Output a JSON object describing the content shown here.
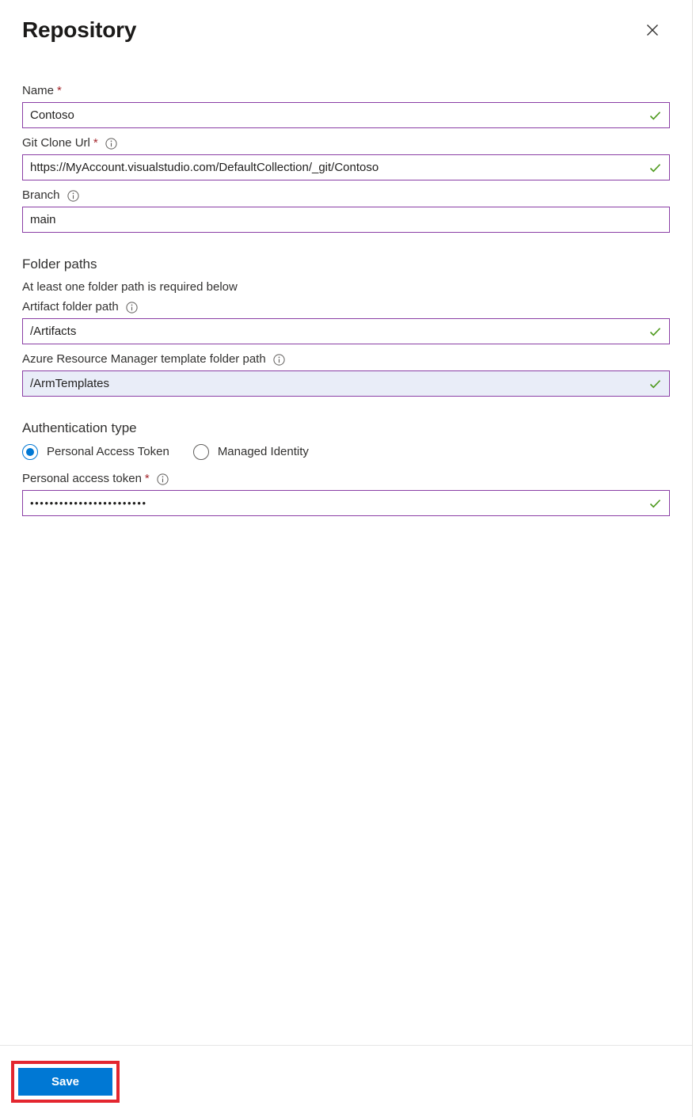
{
  "header": {
    "title": "Repository",
    "close_icon": "close-icon",
    "close_label": "Close"
  },
  "form": {
    "fields": [
      {
        "key": "name",
        "label": "Name",
        "required": true,
        "info": false,
        "value": "Contoso",
        "valid": true,
        "selected": false,
        "masked": false
      },
      {
        "key": "git_clone_url",
        "label": "Git Clone Url",
        "required": true,
        "info": true,
        "value": "https://MyAccount.visualstudio.com/DefaultCollection/_git/Contoso",
        "valid": true,
        "selected": false,
        "masked": false
      },
      {
        "key": "branch",
        "label": "Branch",
        "required": false,
        "info": true,
        "value": "main",
        "valid": false,
        "selected": false,
        "masked": false
      }
    ]
  },
  "folder_paths": {
    "section_title": "Folder paths",
    "hint": "At least one folder path is required below",
    "fields": [
      {
        "key": "artifact_folder_path",
        "label": "Artifact folder path",
        "required": false,
        "info": true,
        "value": "/Artifacts",
        "valid": true,
        "selected": false,
        "masked": false
      },
      {
        "key": "arm_template_folder_path",
        "label": "Azure Resource Manager template folder path",
        "required": false,
        "info": true,
        "value": "/ArmTemplates",
        "valid": true,
        "selected": true,
        "masked": false
      }
    ]
  },
  "authentication": {
    "section_title": "Authentication type",
    "options": [
      {
        "key": "personal-access-token",
        "label": "Personal Access Token",
        "checked": true
      },
      {
        "key": "managed-identity",
        "label": "Managed Identity",
        "checked": false
      }
    ],
    "token_field": {
      "key": "personal_access_token",
      "label": "Personal access token",
      "required": true,
      "info": true,
      "value": "••••••••••••••••••••••••",
      "valid": true,
      "selected": false,
      "masked": true
    }
  },
  "footer": {
    "save_label": "Save",
    "highlight_color": "#e3262f"
  },
  "colors": {
    "accent": "#0078d4",
    "input_border": "#8a3ea5",
    "valid_check": "#4f9a1f",
    "required_star": "#a4262c",
    "selected_field_bg": "#e9edf8",
    "divider": "#e5e5e5"
  }
}
